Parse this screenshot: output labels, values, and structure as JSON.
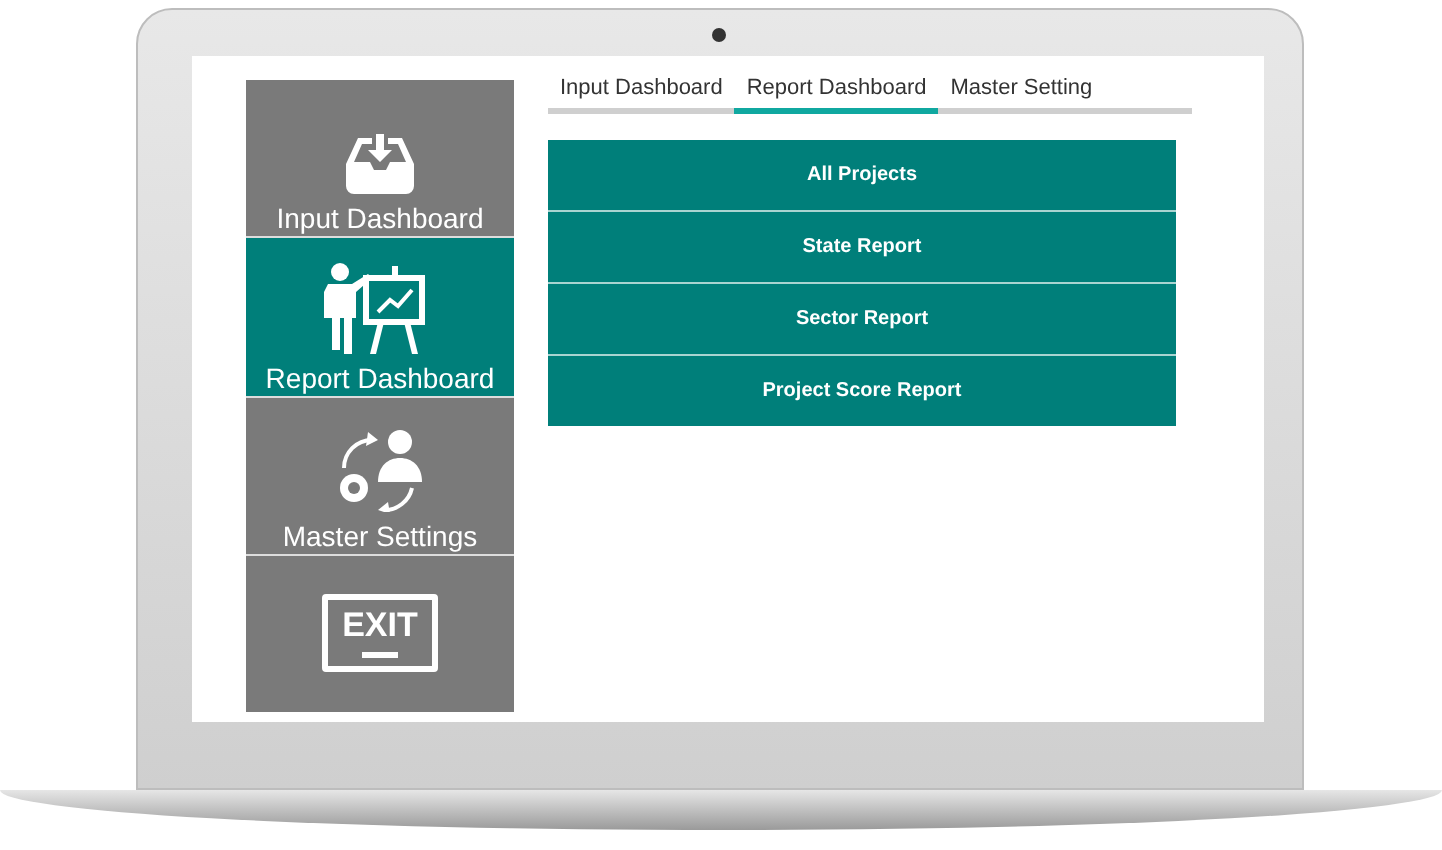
{
  "sidebar": {
    "items": [
      {
        "kind": "nav",
        "label": "Input Dashboard",
        "selected": false
      },
      {
        "kind": "nav",
        "label": "Report Dashboard",
        "selected": true
      },
      {
        "kind": "nav",
        "label": "Master Settings",
        "selected": false
      },
      {
        "kind": "exit",
        "label": "EXIT",
        "selected": false
      }
    ]
  },
  "tabs": [
    {
      "label": "Input Dashboard",
      "selected": false
    },
    {
      "label": "Report Dashboard",
      "selected": true
    },
    {
      "label": "Master Setting",
      "selected": false
    }
  ],
  "report_buttons": [
    "All Projects",
    "State Report",
    "Sector Report",
    "Project Score Report"
  ]
}
